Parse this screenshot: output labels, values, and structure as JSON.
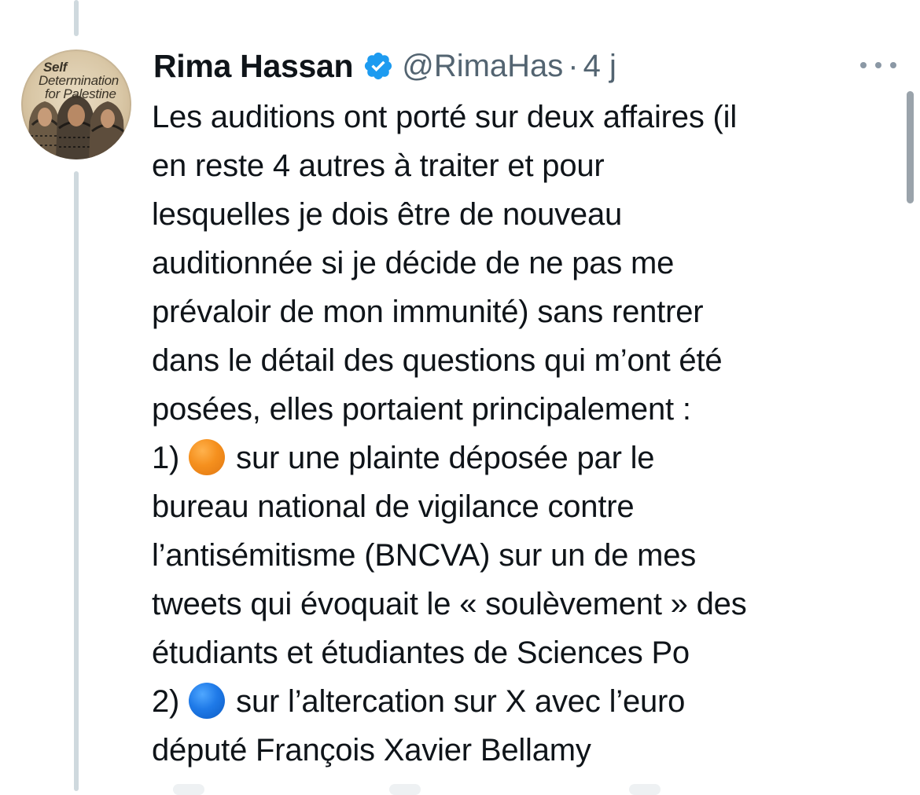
{
  "tweet": {
    "author_name": "Rima Hassan",
    "handle": "@RimaHas",
    "separator": "·",
    "time": "4 j",
    "verified": true,
    "avatar": {
      "text_line1": "Self",
      "text_line2": "Determination",
      "text_line3": "for Palestine"
    },
    "lines": [
      "Les auditions ont porté sur deux affaires (il",
      "en reste 4 autres à traiter et pour",
      "lesquelles je dois être de nouveau",
      "auditionnée si je décide de ne pas me",
      "prévaloir de mon immunité) sans rentrer",
      "dans le détail des questions qui m’ont été",
      "posées, elles portaient principalement :"
    ],
    "point1_prefix": "1)",
    "point1_emoji": "orange-circle",
    "point1_text": "sur une plainte déposée par le",
    "point1_lines": [
      "bureau national de vigilance contre",
      "l’antisémitisme (BNCVA) sur un de mes",
      "tweets qui évoquait le « soulèvement » des",
      "étudiants et étudiantes de Sciences Po"
    ],
    "point2_prefix": "2)",
    "point2_emoji": "blue-circle",
    "point2_text": "sur l’altercation sur X avec l’euro",
    "point2_lines": [
      "député François Xavier Bellamy"
    ]
  },
  "icons": {
    "verified": "verified-badge-icon",
    "more": "more-options-icon"
  },
  "colors": {
    "text": "#0f1419",
    "secondary": "#536471",
    "verified_blue": "#1d9bf0",
    "thread_line": "#cfd9de",
    "emoji_orange": "#f5901e",
    "emoji_blue": "#1f7ae8"
  }
}
